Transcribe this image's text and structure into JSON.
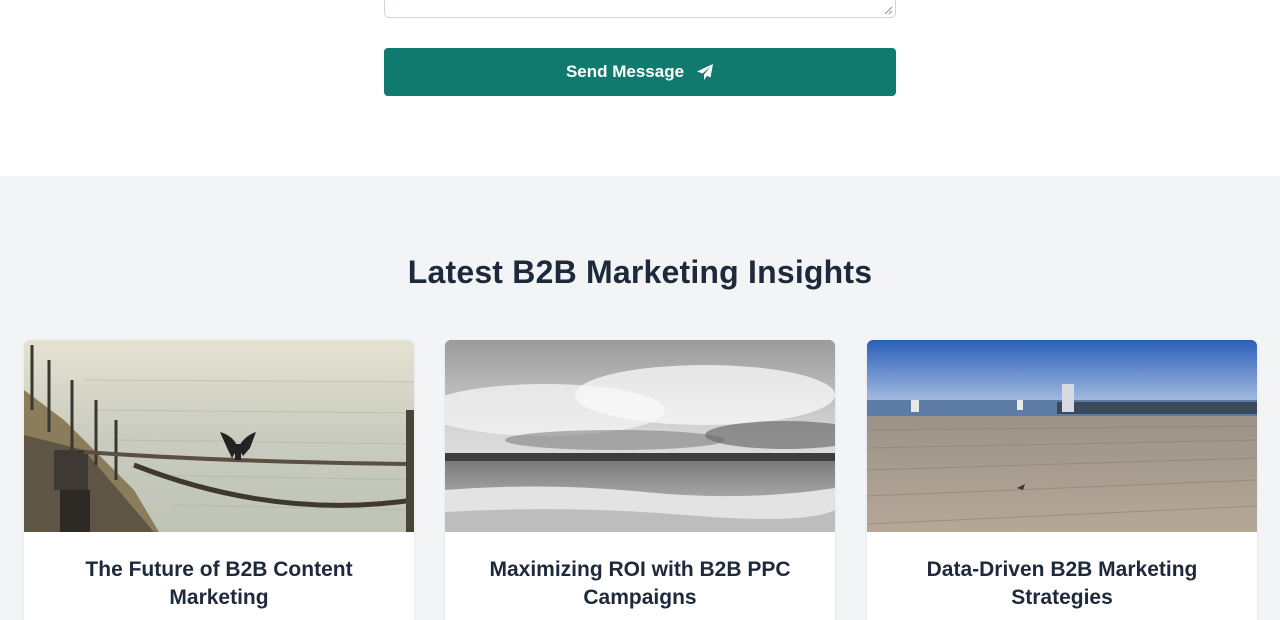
{
  "contact_form": {
    "send_label": "Send Message",
    "send_icon": "paper-plane-icon",
    "button_color": "#117a6f"
  },
  "insights": {
    "title": "Latest B2B Marketing Insights",
    "background": "#f3f4f6",
    "posts": [
      {
        "title": "The Future of B2B Content Marketing",
        "image": "pier-with-cormorant-photo"
      },
      {
        "title": "Maximizing ROI with B2B PPC Campaigns",
        "image": "black-and-white-sea-photo"
      },
      {
        "title": "Data-Driven B2B Marketing Strategies",
        "image": "wooden-boardwalk-photo"
      }
    ]
  }
}
